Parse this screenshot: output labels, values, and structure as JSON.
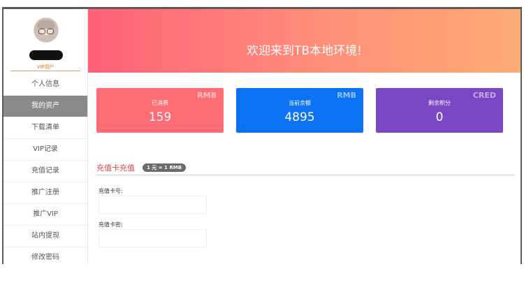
{
  "user": {
    "role": "VIP用户"
  },
  "sidebar": {
    "items": [
      {
        "label": "个人信息",
        "active": false
      },
      {
        "label": "我的资产",
        "active": true
      },
      {
        "label": "下载清单",
        "active": false
      },
      {
        "label": "VIP记录",
        "active": false
      },
      {
        "label": "充值记录",
        "active": false
      },
      {
        "label": "推广注册",
        "active": false
      },
      {
        "label": "推广VIP",
        "active": false
      },
      {
        "label": "站内提现",
        "active": false
      },
      {
        "label": "修改密码",
        "active": false
      }
    ]
  },
  "banner": {
    "title": "欢迎来到TB本地环境!"
  },
  "stats": [
    {
      "tag": "RMB",
      "label": "已消费",
      "value": "159",
      "color": "#fe6d73"
    },
    {
      "tag": "RMB",
      "label": "当前余额",
      "value": "4895",
      "color": "#0c74f4"
    },
    {
      "tag": "CRED",
      "label": "剩余积分",
      "value": "0",
      "color": "#7b47c4"
    }
  ],
  "recharge": {
    "title": "充值卡充值",
    "rate": "1 元 = 1 RMB",
    "card_no_label": "充值卡号:",
    "card_no_value": "",
    "card_pwd_label": "充值卡密:",
    "card_pwd_value": ""
  }
}
